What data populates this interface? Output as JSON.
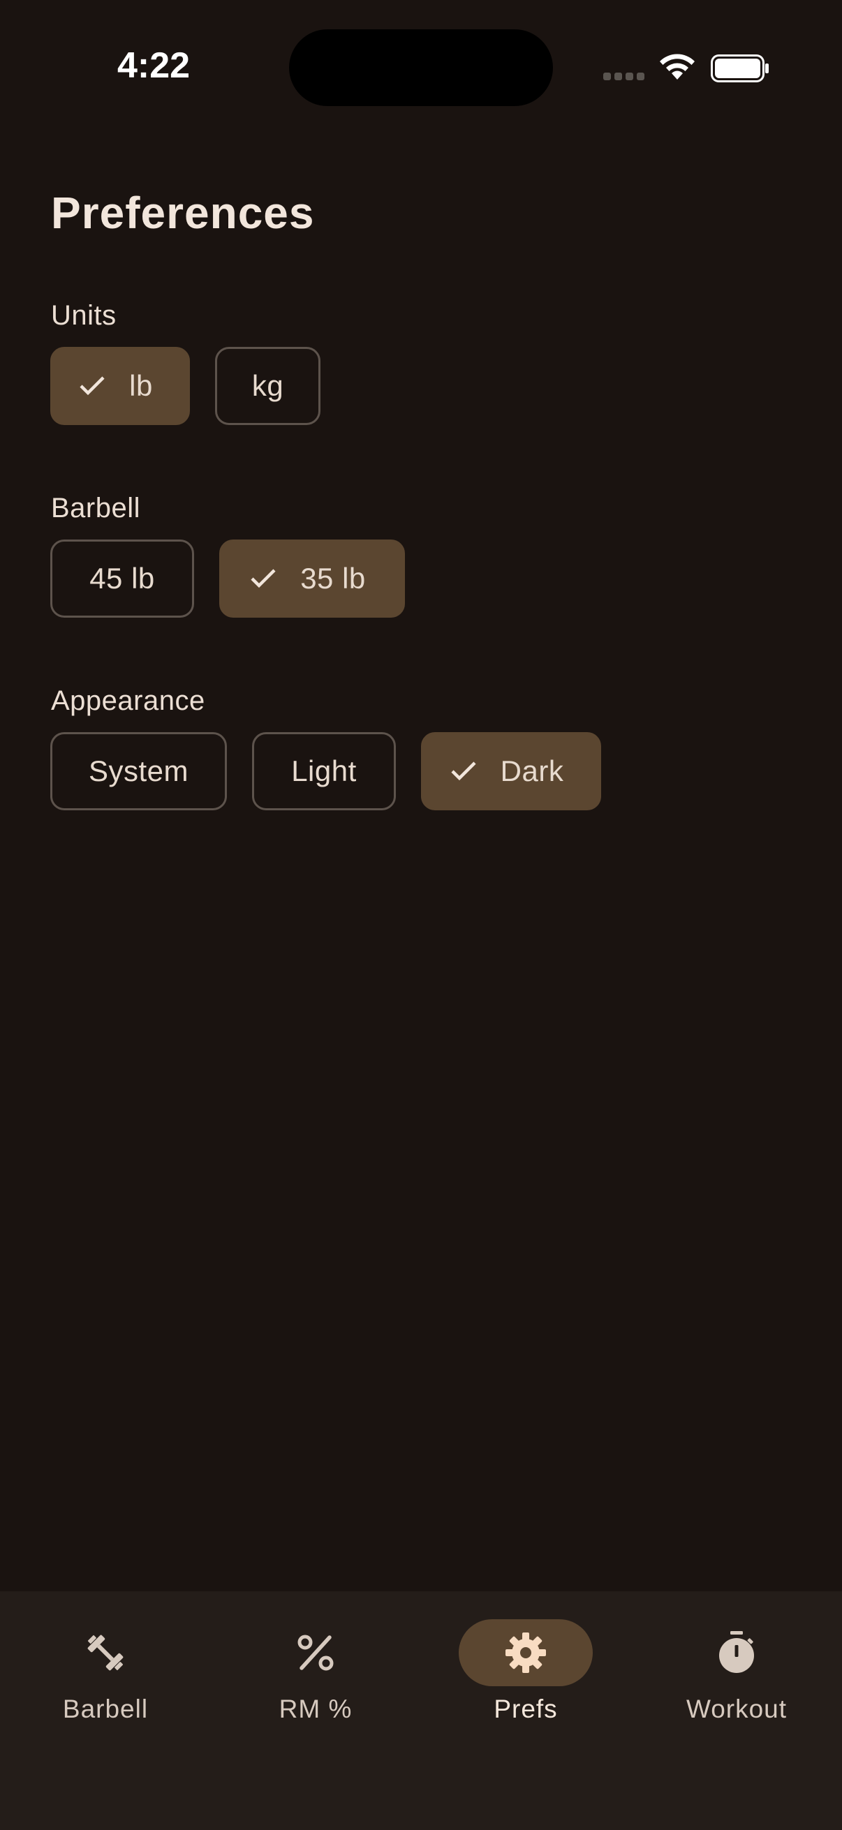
{
  "status_bar": {
    "time": "4:22"
  },
  "page": {
    "title": "Preferences"
  },
  "sections": {
    "units": {
      "label": "Units",
      "options": [
        "lb",
        "kg"
      ],
      "selected": "lb"
    },
    "barbell": {
      "label": "Barbell",
      "options": [
        "45 lb",
        "35 lb"
      ],
      "selected": "35 lb"
    },
    "appearance": {
      "label": "Appearance",
      "options": [
        "System",
        "Light",
        "Dark"
      ],
      "selected": "Dark"
    }
  },
  "bottom_nav": {
    "items": [
      {
        "label": "Barbell",
        "icon": "dumbbell-icon"
      },
      {
        "label": "RM %",
        "icon": "percent-icon"
      },
      {
        "label": "Prefs",
        "icon": "gear-icon"
      },
      {
        "label": "Workout",
        "icon": "stopwatch-icon"
      }
    ],
    "active": "Prefs"
  },
  "colors": {
    "background": "#1a1310",
    "nav_background": "#241d19",
    "accent_selected": "#5b4630",
    "chip_border": "#5d534c",
    "text": "#ecdfd4"
  }
}
